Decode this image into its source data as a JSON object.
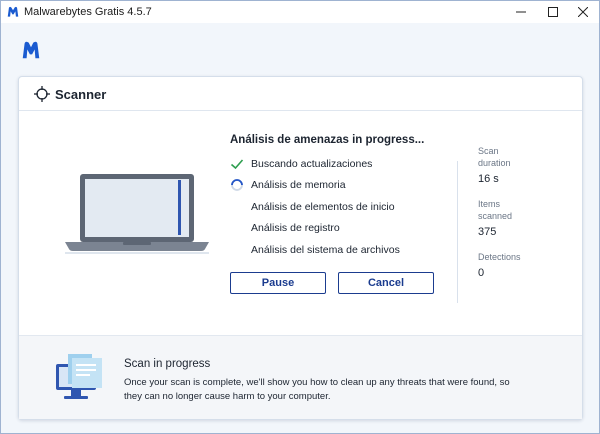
{
  "window": {
    "title": "Malwarebytes Gratis  4.5.7"
  },
  "scanner": {
    "title": "Scanner",
    "heading": "Análisis de amenazas in progress...",
    "tasks": [
      {
        "label": "Buscando actualizaciones",
        "status": "done"
      },
      {
        "label": "Análisis de memoria",
        "status": "running"
      },
      {
        "label": "Análisis de elementos de inicio",
        "status": "pending"
      },
      {
        "label": "Análisis de registro",
        "status": "pending"
      },
      {
        "label": "Análisis del sistema de archivos",
        "status": "pending"
      }
    ],
    "buttons": {
      "pause": "Pause",
      "cancel": "Cancel"
    },
    "stats": {
      "duration_label_1": "Scan",
      "duration_label_2": "duration",
      "duration_value": "16 s",
      "items_label_1": "Items",
      "items_label_2": "scanned",
      "items_value": "375",
      "detections_label": "Detections",
      "detections_value": "0"
    }
  },
  "footer": {
    "title": "Scan in progress",
    "body": "Once your scan is complete, we'll show you how to clean up any threats that were found, so they can no longer cause harm to your computer."
  },
  "icons": {
    "app": "malwarebytes-logo-icon",
    "target": "target-icon",
    "check": "check-icon",
    "spinner": "spinner-icon"
  },
  "colors": {
    "brand_blue": "#1b3c8f",
    "check_green": "#2e9e4f",
    "spinner_blue": "#2456c7"
  }
}
